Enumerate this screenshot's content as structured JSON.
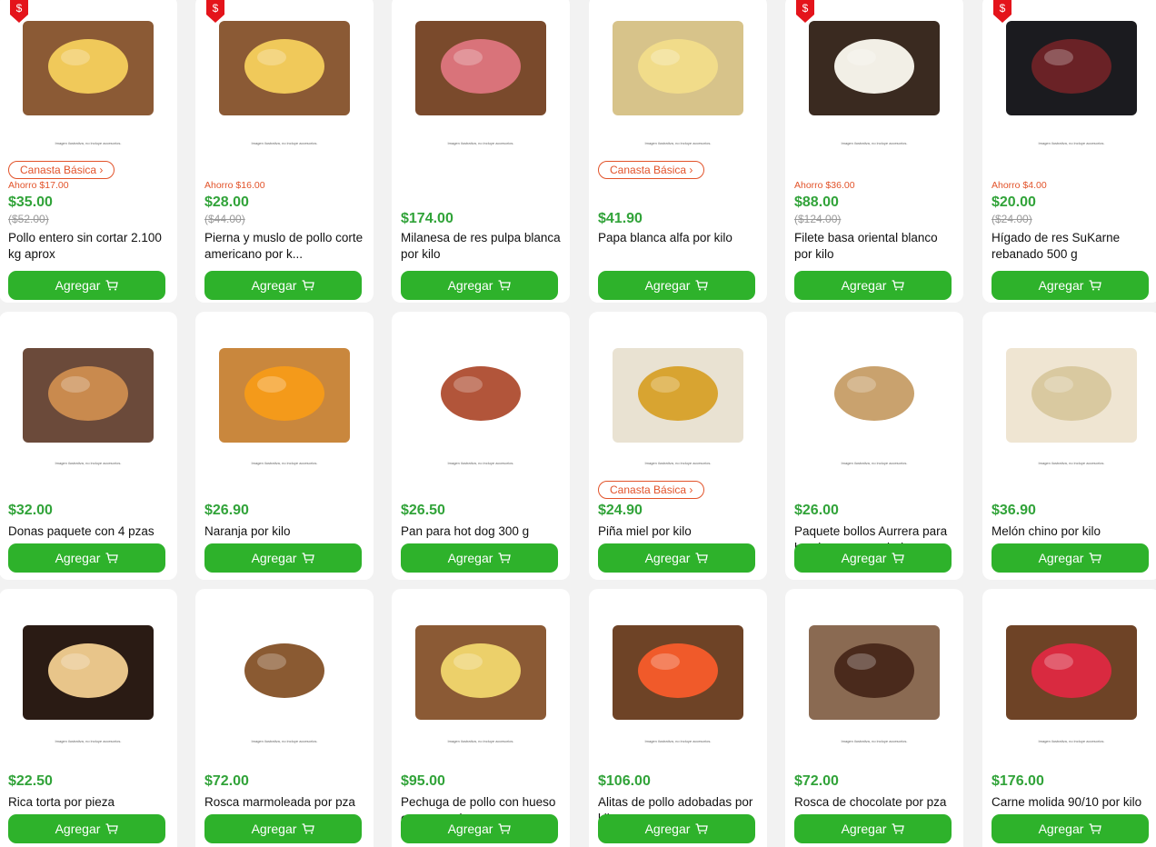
{
  "add_label": "Agregar",
  "img_note": "Imagen ilustrativa, no incluye accesorios.",
  "badge_label": "Canasta Básica",
  "colors": {
    "price": "#31a339",
    "promo": "#e2532a",
    "button": "#2eb22b",
    "flag": "#e4141b"
  },
  "products": [
    {
      "icon": "whole-chicken",
      "promo": true,
      "badge": true,
      "saving": "Ahorro $17.00",
      "price": "$35.00",
      "old_price": "($52.00)",
      "title": "Pollo entero sin cortar 2.100 kg aprox"
    },
    {
      "icon": "chicken-leg",
      "promo": true,
      "badge": false,
      "saving": "Ahorro $16.00",
      "price": "$28.00",
      "old_price": "($44.00)",
      "title": "Pierna y muslo de pollo corte americano por k..."
    },
    {
      "icon": "beef-milanesa",
      "promo": false,
      "badge": false,
      "saving": "",
      "price": "$174.00",
      "old_price": "",
      "title": "Milanesa de res pulpa blanca por kilo"
    },
    {
      "icon": "potato",
      "promo": false,
      "badge": true,
      "saving": "",
      "price": "$41.90",
      "old_price": "",
      "title": "Papa blanca alfa por kilo"
    },
    {
      "icon": "fish-fillet",
      "promo": true,
      "badge": false,
      "saving": "Ahorro $36.00",
      "price": "$88.00",
      "old_price": "($124.00)",
      "title": "Filete basa oriental blanco por kilo"
    },
    {
      "icon": "beef-liver-pack",
      "promo": true,
      "badge": false,
      "saving": "Ahorro $4.00",
      "price": "$20.00",
      "old_price": "($24.00)",
      "title": "Hígado de res SuKarne rebanado 500 g"
    },
    {
      "icon": "donuts",
      "promo": false,
      "badge": false,
      "saving": "",
      "price": "$32.00",
      "old_price": "",
      "title": "Donas paquete con 4 pzas"
    },
    {
      "icon": "orange",
      "promo": false,
      "badge": false,
      "saving": "",
      "price": "$26.90",
      "old_price": "",
      "title": "Naranja por kilo"
    },
    {
      "icon": "hot-dog-bread",
      "promo": false,
      "badge": false,
      "saving": "",
      "price": "$26.50",
      "old_price": "",
      "title": "Pan para hot dog 300 g"
    },
    {
      "icon": "pineapple",
      "promo": false,
      "badge": true,
      "saving": "",
      "price": "$24.90",
      "old_price": "",
      "title": "Piña miel por kilo"
    },
    {
      "icon": "burger-buns",
      "promo": false,
      "badge": false,
      "saving": "",
      "price": "$26.00",
      "old_price": "",
      "title": "Paquete bollos Aurrera para hamburgesa por bol..."
    },
    {
      "icon": "melon",
      "promo": false,
      "badge": false,
      "saving": "",
      "price": "$36.90",
      "old_price": "",
      "title": "Melón chino por kilo"
    },
    {
      "icon": "torta",
      "promo": false,
      "badge": false,
      "saving": "",
      "price": "$22.50",
      "old_price": "",
      "title": "Rica torta por pieza"
    },
    {
      "icon": "marble-cake",
      "promo": false,
      "badge": false,
      "saving": "",
      "price": "$72.00",
      "old_price": "",
      "title": "Rosca marmoleada por pza"
    },
    {
      "icon": "chicken-breast",
      "promo": false,
      "badge": false,
      "saving": "",
      "price": "$95.00",
      "old_price": "",
      "title": "Pechuga de pollo con hueso corte americano po..."
    },
    {
      "icon": "chicken-wings",
      "promo": false,
      "badge": false,
      "saving": "",
      "price": "$106.00",
      "old_price": "",
      "title": "Alitas de pollo adobadas por kilo"
    },
    {
      "icon": "chocolate-cake",
      "promo": false,
      "badge": false,
      "saving": "",
      "price": "$72.00",
      "old_price": "",
      "title": "Rosca de chocolate por pza"
    },
    {
      "icon": "ground-beef",
      "promo": false,
      "badge": false,
      "saving": "",
      "price": "$176.00",
      "old_price": "",
      "title": "Carne molida 90/10 por kilo"
    }
  ]
}
